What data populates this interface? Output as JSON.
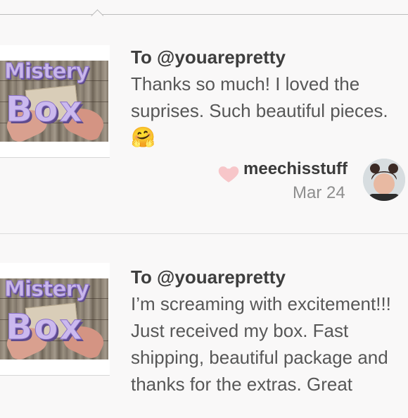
{
  "reviews": [
    {
      "to": "To @youarepretty",
      "text": "Thanks so much! I loved the suprises. Such beautiful pieces.",
      "emoji": "🤗",
      "username": "meechisstuff",
      "date": "Mar 24",
      "thumbnail": {
        "line1": "Mistery",
        "line2": "Box"
      }
    },
    {
      "to": "To @youarepretty",
      "text": "I’m screaming with excitement!!! Just received my box. Fast shipping, beautiful package and thanks for the extras. Great",
      "thumbnail": {
        "line1": "Mistery",
        "line2": "Box"
      }
    }
  ],
  "icons": {
    "like": "heart-icon",
    "avatar": "user-avatar"
  },
  "colors": {
    "heart": "#f7c6c9",
    "background": "#f9f8f8",
    "thumbnail_text": "#c9b7ea"
  }
}
